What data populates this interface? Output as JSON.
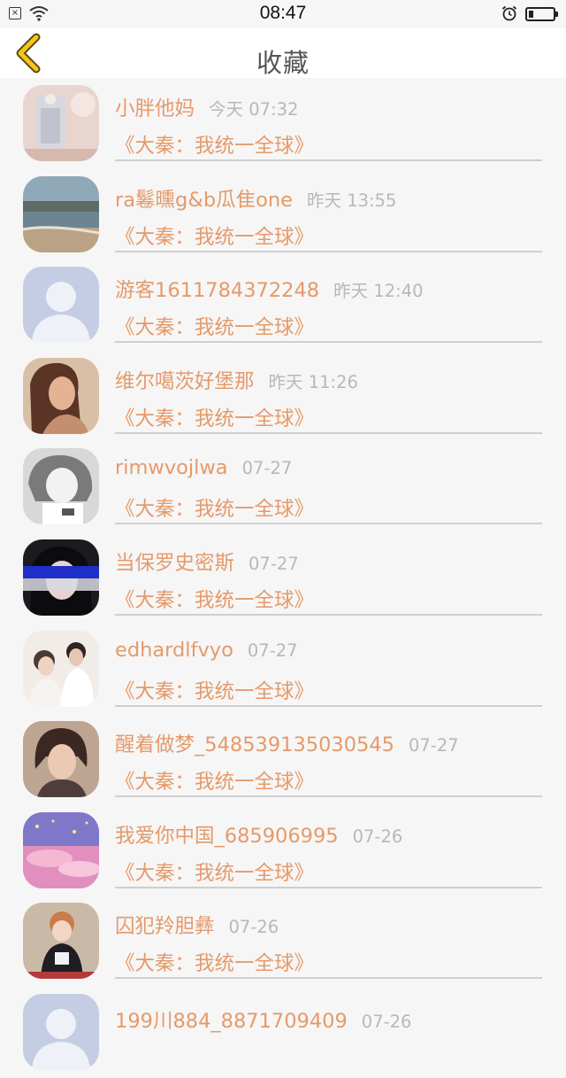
{
  "status_bar": {
    "time": "08:47",
    "battery_level": 0.2
  },
  "header": {
    "title": "收藏",
    "back_icon": "chevron-left-icon",
    "accent_color": "#f5c518"
  },
  "colors": {
    "name": "#e59a6a",
    "time": "#b8b8b8",
    "divider": "#cfcfcf"
  },
  "favorites": [
    {
      "name": "小胖他妈",
      "time": "今天 07:32",
      "book": "《大秦：我统一全球》"
    },
    {
      "name": "ra鬈曛g&b瓜隹one",
      "time": "昨天 13:55",
      "book": "《大秦：我统一全球》"
    },
    {
      "name": "游客1611784372248",
      "time": "昨天 12:40",
      "book": "《大秦：我统一全球》"
    },
    {
      "name": "维尔噶茨好堡那",
      "time": "昨天 11:26",
      "book": "《大秦：我统一全球》"
    },
    {
      "name": "rimwvojlwa",
      "time": "07-27",
      "book": "《大秦：我统一全球》"
    },
    {
      "name": "当保罗史密斯",
      "time": "07-27",
      "book": "《大秦：我统一全球》"
    },
    {
      "name": "edhardlfvyo",
      "time": "07-27",
      "book": "《大秦：我统一全球》"
    },
    {
      "name": "醒着做梦_548539135030545",
      "time": "07-27",
      "book": "《大秦：我统一全球》"
    },
    {
      "name": "我爱你中国_685906995",
      "time": "07-26",
      "book": "《大秦：我统一全球》"
    },
    {
      "name": "囚犯羚胆彝",
      "time": "07-26",
      "book": "《大秦：我统一全球》"
    },
    {
      "name": "199川884_8871709409",
      "time": "07-26",
      "book": ""
    }
  ]
}
